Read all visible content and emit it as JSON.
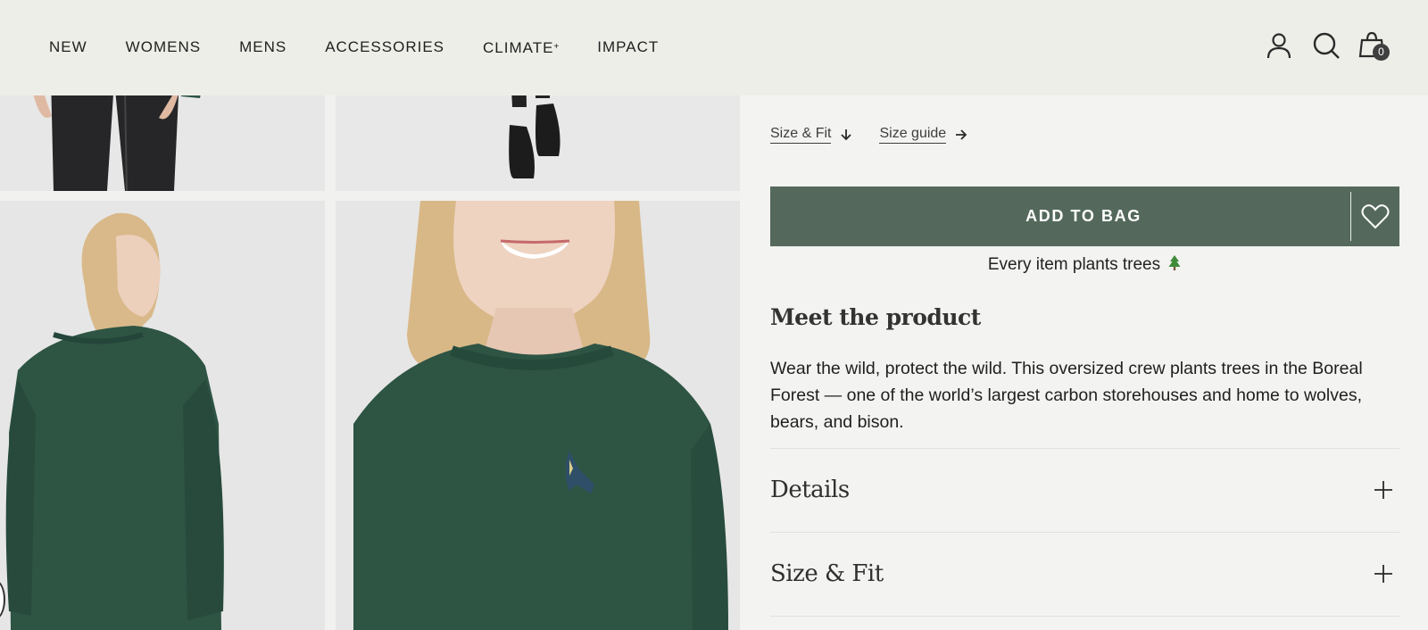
{
  "nav": {
    "items": [
      {
        "label": "NEW"
      },
      {
        "label": "WOMENS"
      },
      {
        "label": "MENS"
      },
      {
        "label": "ACCESSORIES"
      },
      {
        "label": "CLIMATE",
        "suffix": "+"
      },
      {
        "label": "IMPACT"
      }
    ]
  },
  "header": {
    "icons": [
      "account-icon",
      "search-icon",
      "shopping-bag-icon"
    ],
    "bag_count": "0"
  },
  "product": {
    "size_fit_link": "Size & Fit",
    "size_guide_link": "Size guide",
    "add_to_bag": "ADD TO BAG",
    "tagline": "Every item plants trees",
    "meet_title": "Meet the product",
    "description": "Wear the wild, protect the wild. This oversized crew plants trees in the Boreal Forest — one of the world’s largest carbon storehouses and home to wolves, bears, and bison.",
    "accordions": [
      {
        "title": "Details"
      },
      {
        "title": "Size & Fit"
      }
    ]
  },
  "colors": {
    "button": "#54695c",
    "sweater": "#2e5444",
    "header_bg": "#eeeee9",
    "page_bg": "#f3f3f1"
  }
}
